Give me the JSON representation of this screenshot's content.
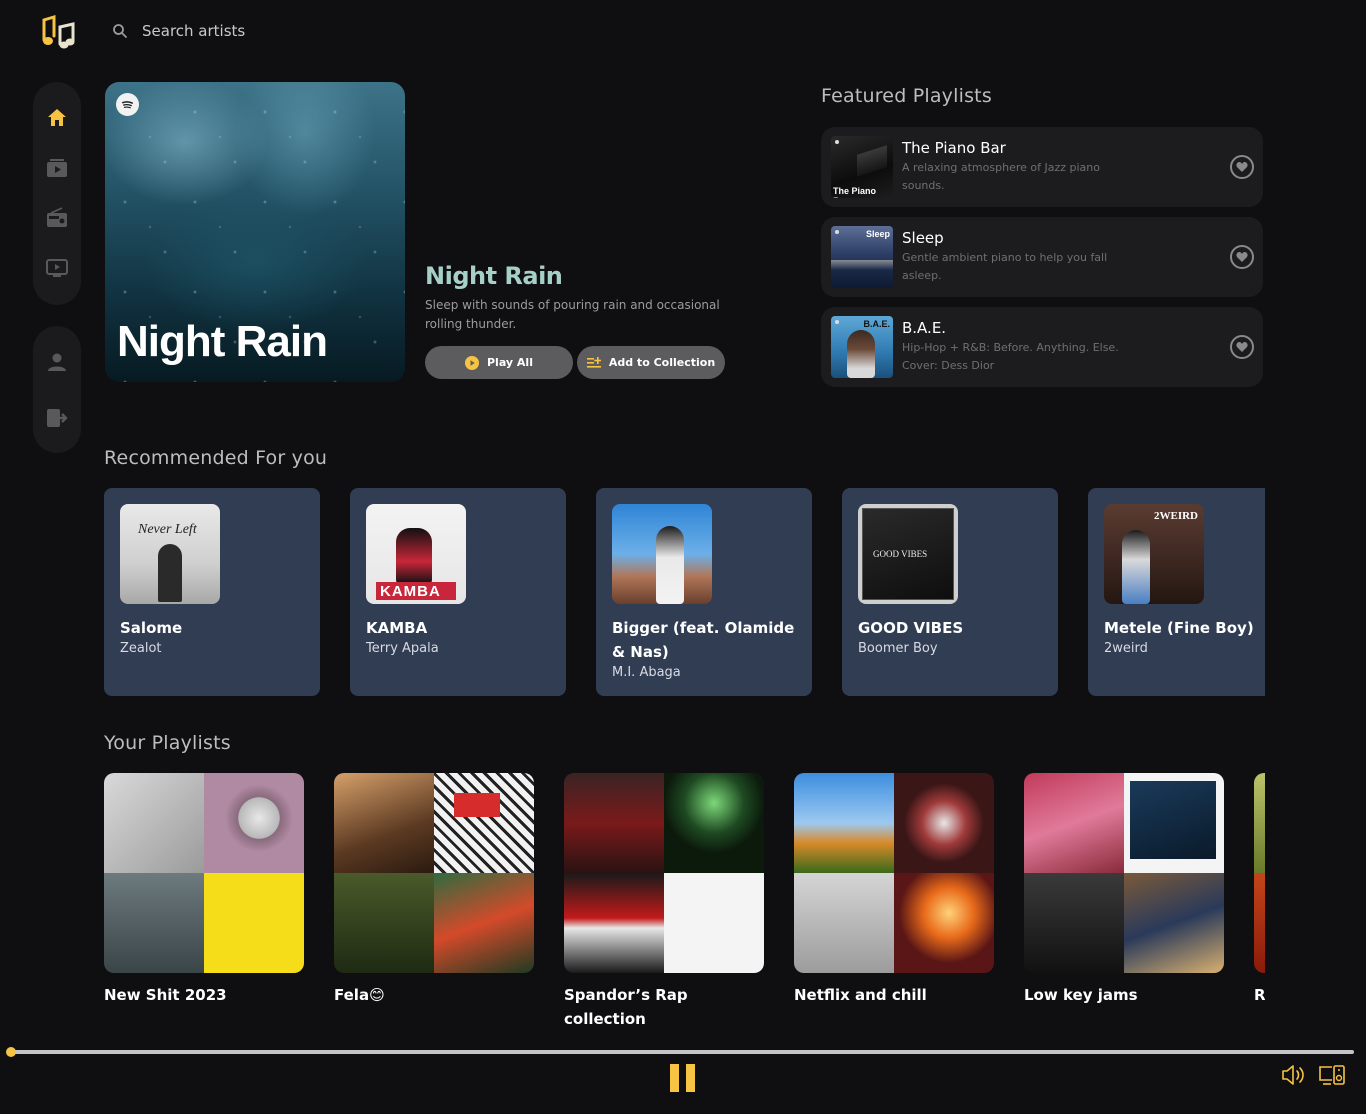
{
  "search": {
    "placeholder": "Search artists"
  },
  "sidebar": {
    "nav_items": [
      {
        "name": "home",
        "icon": "home-icon",
        "active": true
      },
      {
        "name": "videos",
        "icon": "video-library-icon"
      },
      {
        "name": "radio",
        "icon": "radio-icon"
      },
      {
        "name": "tv",
        "icon": "tv-icon"
      }
    ],
    "account_items": [
      {
        "name": "profile",
        "icon": "user-icon"
      },
      {
        "name": "logout",
        "icon": "logout-icon"
      }
    ]
  },
  "hero": {
    "cover_title": "Night Rain",
    "title": "Night Rain",
    "description": "Sleep with sounds of pouring rain and occasional rolling thunder.",
    "play_label": "Play All",
    "add_label": "Add to Collection"
  },
  "featured": {
    "title": "Featured Playlists",
    "items": [
      {
        "name": "The Piano Bar",
        "description": "A relaxing atmosphere of Jazz piano sounds.",
        "cover_text": "The Piano Bar"
      },
      {
        "name": "Sleep",
        "description": "Gentle ambient piano to help you fall asleep.",
        "cover_text": "Sleep"
      },
      {
        "name": "B.A.E.",
        "description": "Hip-Hop + R&B: Before. Anything. Else. Cover: Dess Dior",
        "cover_text": "B.A.E."
      }
    ]
  },
  "recommended": {
    "title": "Recommended For you",
    "items": [
      {
        "title": "Salome",
        "artist": "Zealot",
        "cover_text": "Never Left"
      },
      {
        "title": "KAMBA",
        "artist": "Terry Apala",
        "cover_text": "KAMBA"
      },
      {
        "title": "Bigger (feat. Olamide & Nas)",
        "artist": "M.I. Abaga"
      },
      {
        "title": "GOOD VIBES",
        "artist": "Boomer Boy",
        "cover_text": "GOOD VIBES"
      },
      {
        "title": "Metele (Fine Boy)",
        "artist": "2weird",
        "cover_text": "2WEIRD"
      }
    ]
  },
  "playlists": {
    "title": "Your Playlists",
    "items": [
      {
        "name": "New Shit 2023"
      },
      {
        "name": "Fela😊"
      },
      {
        "name": "Spandor’s Rap collection"
      },
      {
        "name": "Netflix and chill"
      },
      {
        "name": "Low key jams"
      },
      {
        "name": "R"
      }
    ]
  },
  "player": {
    "progress": 0.0,
    "state": "playing",
    "controls": [
      "pause-icon",
      "volume-icon",
      "device-icon"
    ]
  },
  "colors": {
    "background": "#0f0e10",
    "accent": "#f6c343",
    "card": "#313d53",
    "hero_title": "#a6d0c6"
  }
}
